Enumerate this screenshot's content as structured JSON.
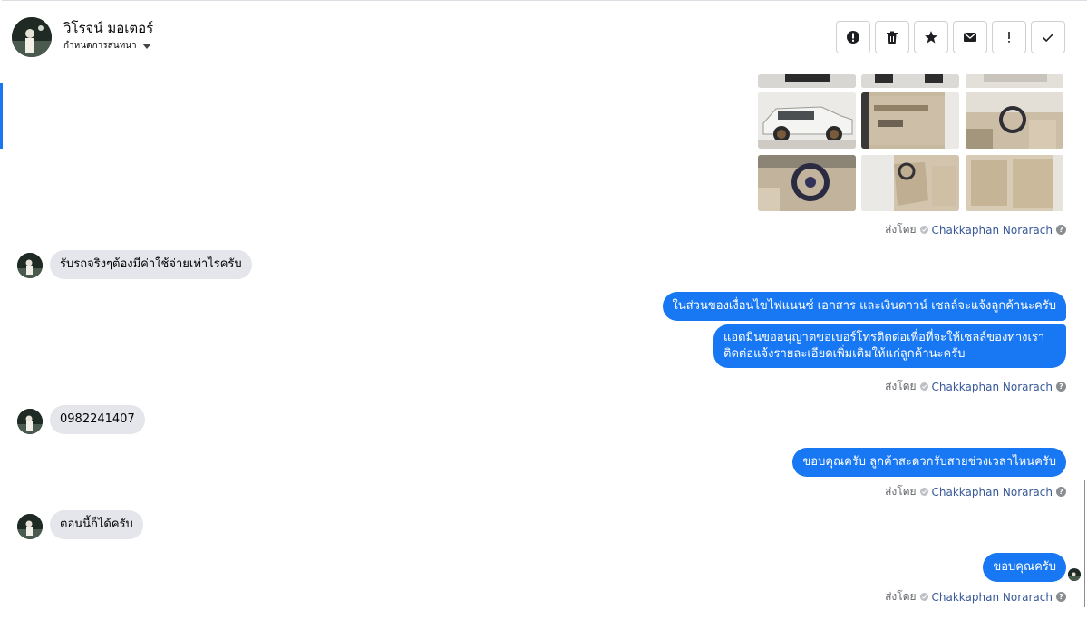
{
  "conversation": {
    "contact_name": "วิโรจน์ มอเตอร์",
    "contact_subtitle": "กำหนดการสนทนา"
  },
  "toolbar": {
    "buttons": [
      {
        "name": "report-spam-button",
        "icon": "alert-circle-icon"
      },
      {
        "name": "delete-button",
        "icon": "trash-icon"
      },
      {
        "name": "star-button",
        "icon": "star-icon"
      },
      {
        "name": "mark-unread-button",
        "icon": "envelope-icon"
      },
      {
        "name": "follow-up-button",
        "icon": "exclamation-icon"
      },
      {
        "name": "mark-done-button",
        "icon": "checkmark-icon"
      }
    ]
  },
  "sent_by_label": "ส่งโดย",
  "agent_name": "Chakkaphan Norarach",
  "messages": {
    "in_1": "รับรถจริงๆต้องมีค่าใช้จ่ายเท่าไรครับ",
    "out_1a": "ในส่วนของเงื่อนไขไฟแนนซ์ เอกสาร และเงินดาวน์ เซลล์จะแจ้งลูกค้านะครับ",
    "out_1b": "แอดมินขออนุญาตขอเบอร์โทรติดต่อเพื่อที่จะให้เซลล์ของทางเราติดต่อแจ้งรายละเอียดเพิ่มเติมให้แก่ลูกค้านะครับ",
    "in_2": "0982241407",
    "out_2": "ขอบคุณครับ ลูกค้าสะดวกรับสายช่วงเวลาไหนครับ",
    "in_3": "ตอนนี้ก็ได้ครับ",
    "out_3": "ขอบคุณครับ"
  },
  "colors": {
    "accent": "#1877f2",
    "incoming_bubble": "#e4e6eb",
    "agent_link": "#385898"
  }
}
